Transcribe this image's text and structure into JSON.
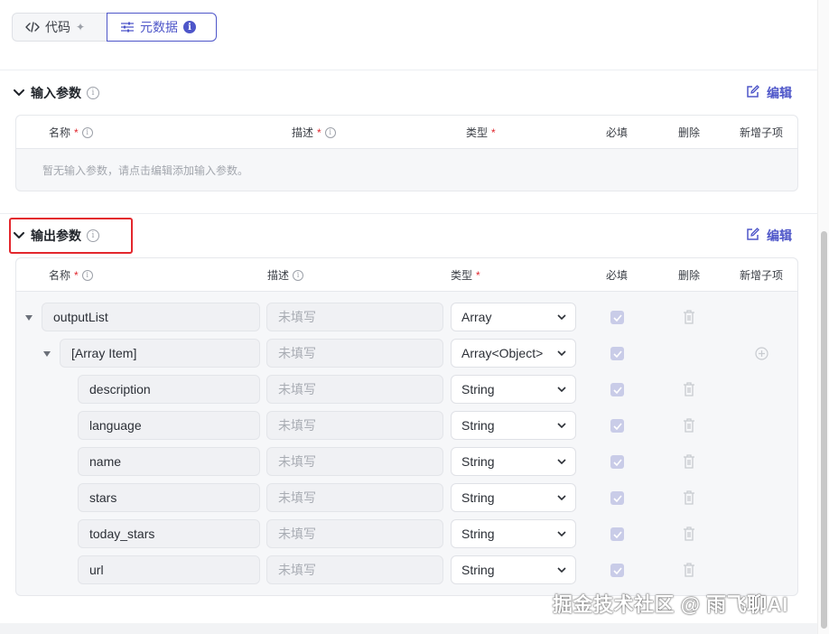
{
  "tabs": [
    {
      "label": "代码",
      "icon": "code-icon"
    },
    {
      "label": "元数据",
      "icon": "sliders-icon",
      "badge": "i"
    }
  ],
  "input_section": {
    "title": "输入参数",
    "edit_label": "编辑",
    "columns": {
      "name": "名称",
      "desc": "描述",
      "type": "类型",
      "required": "必填",
      "delete": "删除",
      "add_child": "新增子项"
    },
    "empty_message": "暂无输入参数，请点击编辑添加输入参数。"
  },
  "output_section": {
    "title": "输出参数",
    "edit_label": "编辑",
    "columns": {
      "name": "名称",
      "desc": "描述",
      "type": "类型",
      "required": "必填",
      "delete": "删除",
      "add_child": "新增子项"
    },
    "rows": [
      {
        "name": "outputList",
        "desc_placeholder": "未填写",
        "type": "Array"
      },
      {
        "name": "[Array Item]",
        "desc_placeholder": "未填写",
        "type": "Array<Object>"
      },
      {
        "name": "description",
        "desc_placeholder": "未填写",
        "type": "String"
      },
      {
        "name": "language",
        "desc_placeholder": "未填写",
        "type": "String"
      },
      {
        "name": "name",
        "desc_placeholder": "未填写",
        "type": "String"
      },
      {
        "name": "stars",
        "desc_placeholder": "未填写",
        "type": "String"
      },
      {
        "name": "today_stars",
        "desc_placeholder": "未填写",
        "type": "String"
      },
      {
        "name": "url",
        "desc_placeholder": "未填写",
        "type": "String"
      }
    ]
  },
  "watermark": "掘金技术社区 @ 雨飞聊AI",
  "colors": {
    "accent": "#4e56c9",
    "required": "#e0262d",
    "highlight": "#e3272d"
  }
}
